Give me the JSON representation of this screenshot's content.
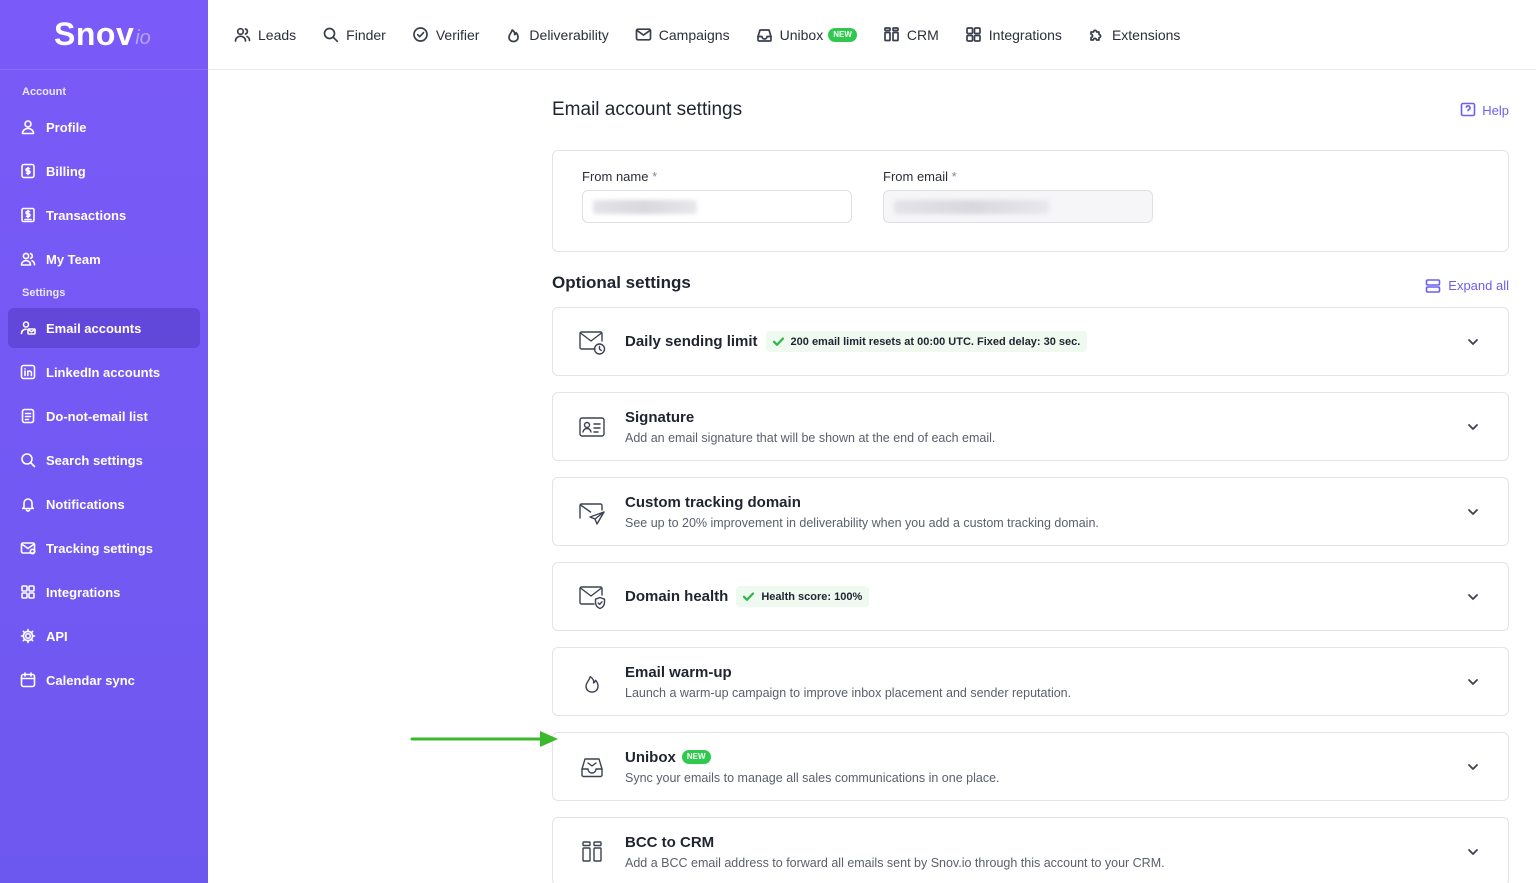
{
  "sidebar": {
    "logo_main": "Snov",
    "logo_suffix": "io",
    "section_account": "Account",
    "section_settings": "Settings",
    "account_items": [
      {
        "label": "Profile",
        "icon": "user-icon"
      },
      {
        "label": "Billing",
        "icon": "billing-icon"
      },
      {
        "label": "Transactions",
        "icon": "transactions-icon"
      },
      {
        "label": "My Team",
        "icon": "team-icon"
      }
    ],
    "settings_items": [
      {
        "label": "Email accounts",
        "icon": "email-accounts-icon",
        "active": true
      },
      {
        "label": "LinkedIn accounts",
        "icon": "linkedin-icon"
      },
      {
        "label": "Do-not-email list",
        "icon": "list-icon"
      },
      {
        "label": "Search settings",
        "icon": "search-icon"
      },
      {
        "label": "Notifications",
        "icon": "bell-icon"
      },
      {
        "label": "Tracking settings",
        "icon": "tracking-icon"
      },
      {
        "label": "Integrations",
        "icon": "grid-icon"
      },
      {
        "label": "API",
        "icon": "gear-icon"
      },
      {
        "label": "Calendar sync",
        "icon": "calendar-icon"
      }
    ]
  },
  "topnav": {
    "items": [
      {
        "label": "Leads",
        "icon": "users-icon"
      },
      {
        "label": "Finder",
        "icon": "search-icon"
      },
      {
        "label": "Verifier",
        "icon": "check-circle-icon"
      },
      {
        "label": "Deliverability",
        "icon": "flame-icon"
      },
      {
        "label": "Campaigns",
        "icon": "mail-icon"
      },
      {
        "label": "Unibox",
        "icon": "inbox-icon",
        "badge": "NEW"
      },
      {
        "label": "CRM",
        "icon": "crm-icon"
      },
      {
        "label": "Integrations",
        "icon": "grid-icon"
      },
      {
        "label": "Extensions",
        "icon": "puzzle-icon"
      }
    ]
  },
  "main": {
    "title": "Email account settings",
    "help_label": "Help",
    "from_name_label": "From name",
    "from_email_label": "From email",
    "required_mark": "*",
    "optional_title": "Optional settings",
    "expand_all_label": "Expand all",
    "sections": [
      {
        "title": "Daily sending limit",
        "status": "200 email limit resets at 00:00 UTC. Fixed delay: 30 sec.",
        "icon": "mail-clock-icon"
      },
      {
        "title": "Signature",
        "description": "Add an email signature that will be shown at the end of each email.",
        "icon": "signature-card-icon"
      },
      {
        "title": "Custom tracking domain",
        "description": "See up to 20% improvement in deliverability when you add a custom tracking domain.",
        "icon": "send-tracking-icon"
      },
      {
        "title": "Domain health",
        "status": "Health score: 100%",
        "icon": "mail-shield-icon"
      },
      {
        "title": "Email warm-up",
        "description": "Launch a warm-up campaign to improve inbox placement and sender reputation.",
        "icon": "flame-icon"
      },
      {
        "title": "Unibox",
        "badge": "NEW",
        "description": "Sync your emails to manage all sales communications in one place.",
        "icon": "inbox-icon"
      },
      {
        "title": "BCC to CRM",
        "description": "Add a BCC email address to forward all emails sent by Snov.io through this account to your CRM.",
        "icon": "crm-icon"
      }
    ]
  },
  "colors": {
    "sidebar": "#7a5af8",
    "accent": "#6d5ff0",
    "new_badge": "#2fc94e",
    "arrow": "#3cb82e"
  }
}
